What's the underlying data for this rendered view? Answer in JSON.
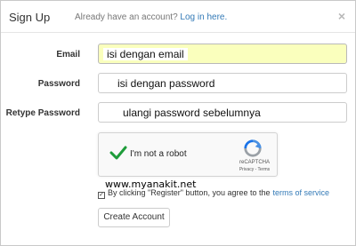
{
  "header": {
    "title": "Sign Up",
    "subtitle_text": "Already have an account?",
    "login_link": "Log in here.",
    "close": "×"
  },
  "form": {
    "email": {
      "label": "Email",
      "value": "isi dengan email"
    },
    "password": {
      "label": "Password",
      "value": "isi dengan password"
    },
    "retype": {
      "label": "Retype Password",
      "value": "ulangi password sebelumnya"
    }
  },
  "recaptcha": {
    "text": "I'm not a robot",
    "brand": "reCAPTCHA",
    "links": "Privacy - Terms"
  },
  "watermark": "www.myanakit.net",
  "agree": {
    "text": "By clicking \"Register\" button, you agree to the",
    "link": "terms of service"
  },
  "submit_label": "Create Account",
  "colors": {
    "autofill_bg": "#faffbd",
    "link": "#337ab7",
    "check_green": "#1e9c3a"
  }
}
